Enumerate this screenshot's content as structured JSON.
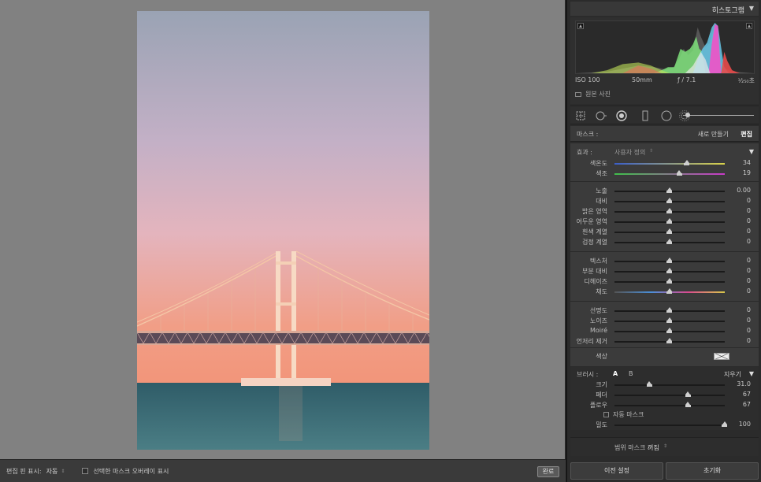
{
  "canvas": {
    "photo_alt": "Gwangan Bridge at sunset",
    "colors": {
      "background": "#818181",
      "sky_top": "#9aa3b4",
      "sky_bottom": "#f09a7c",
      "sea": "#3d6d76"
    }
  },
  "bottom_bar": {
    "pin_label": "편집 핀 표시:",
    "pin_value": "자동",
    "overlay_label": "선택한 마스크 오버레이 표시",
    "done_label": "완료"
  },
  "histogram": {
    "title": "히스토그램",
    "iso": "ISO 100",
    "focal": "50mm",
    "aperture": "ƒ / 7.1",
    "shutter": "¹⁄₂₅₀초",
    "original_photo_label": "원본 사진"
  },
  "tools": {
    "icons": [
      "crop-grid-icon",
      "spot-removal-icon",
      "radial-filter-icon",
      "graduated-filter-icon",
      "adjustment-brush-icon",
      "range-mask-icon"
    ]
  },
  "mask": {
    "label": "마스크 :",
    "new_label": "새로 만들기",
    "edit_label": "편집"
  },
  "effects": {
    "label": "효과 :",
    "preset": "사용자 정의",
    "groups": [
      [
        {
          "label": "색온도",
          "value": "34",
          "pos": 0.66,
          "track": "temp"
        },
        {
          "label": "색조",
          "value": "19",
          "pos": 0.59,
          "track": "tint"
        }
      ],
      [
        {
          "label": "노출",
          "value": "0.00",
          "pos": 0.5
        },
        {
          "label": "대비",
          "value": "0",
          "pos": 0.5
        },
        {
          "label": "밝은 영역",
          "value": "0",
          "pos": 0.5
        },
        {
          "label": "어두운 영역",
          "value": "0",
          "pos": 0.5
        },
        {
          "label": "흰색 계열",
          "value": "0",
          "pos": 0.5
        },
        {
          "label": "검정 계열",
          "value": "0",
          "pos": 0.5
        }
      ],
      [
        {
          "label": "텍스처",
          "value": "0",
          "pos": 0.5
        },
        {
          "label": "부분 대비",
          "value": "0",
          "pos": 0.5
        },
        {
          "label": "디헤이즈",
          "value": "0",
          "pos": 0.5
        },
        {
          "label": "채도",
          "value": "0",
          "pos": 0.5,
          "track": "sat"
        }
      ],
      [
        {
          "label": "선명도",
          "value": "0",
          "pos": 0.5
        },
        {
          "label": "노이즈",
          "value": "0",
          "pos": 0.5
        },
        {
          "label": "Moiré",
          "value": "0",
          "pos": 0.5
        },
        {
          "label": "언저리 제거",
          "value": "0",
          "pos": 0.5
        }
      ]
    ],
    "color_label": "색상"
  },
  "brush": {
    "label": "브러시 :",
    "tab_a": "A",
    "tab_b": "B",
    "erase_label": "지우기",
    "rows": [
      {
        "label": "크기",
        "value": "31.0",
        "pos": 0.32
      },
      {
        "label": "페더",
        "value": "67",
        "pos": 0.67
      },
      {
        "label": "플로우",
        "value": "67",
        "pos": 0.67
      }
    ],
    "auto_mask_label": "자동 마스크",
    "density": {
      "label": "밀도",
      "value": "100",
      "pos": 1.0
    }
  },
  "range_mask": {
    "label": "범위 마스크 :",
    "value": "꺼짐"
  },
  "footer": {
    "previous_label": "이전 설정",
    "reset_label": "초기화"
  }
}
